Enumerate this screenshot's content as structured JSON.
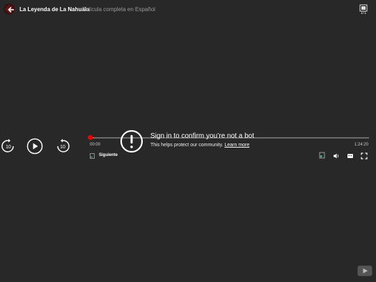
{
  "header": {
    "title": "La Leyenda de La Nahuala",
    "subtitle": "Pelicula completa en Español",
    "playlist_count": "1/1"
  },
  "player": {
    "current_time": "00:00",
    "duration": "1:24:20",
    "progress": 0.0,
    "next_label": "Siguiente",
    "rewind_seconds": "10",
    "forward_seconds": "10"
  },
  "notice": {
    "title": "Sign in to confirm you’re not a bot",
    "body": "This helps protect our community.",
    "link": "Learn more"
  },
  "colors": {
    "background": "#282828",
    "accent": "#e60000"
  },
  "icons": [
    "back-icon",
    "playlist-icon",
    "rewind-10-icon",
    "play-icon",
    "forward-10-icon",
    "settings-icon",
    "volume-icon",
    "captions-icon",
    "fullscreen-icon",
    "youtube-logo-icon",
    "warning-icon"
  ]
}
